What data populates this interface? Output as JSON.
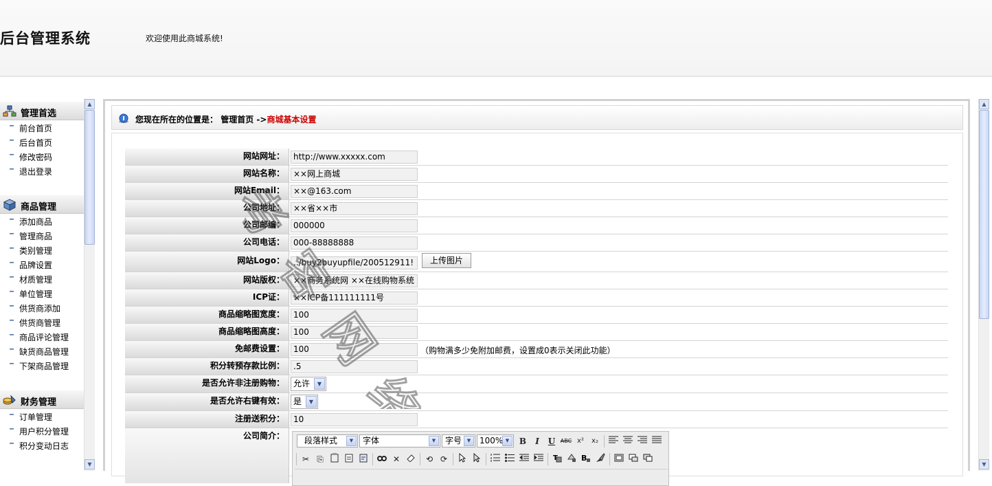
{
  "header": {
    "system_title": "后台管理系统",
    "welcome": "欢迎使用此商城系统!"
  },
  "sidebar": {
    "groups": [
      {
        "title": "管理首选",
        "icon": "sitemap-icon",
        "items": [
          "前台首页",
          "后台首页",
          "修改密码",
          "退出登录"
        ]
      },
      {
        "title": "商品管理",
        "icon": "box-icon",
        "items": [
          "添加商品",
          "管理商品",
          "类别管理",
          "品牌设置",
          "材质管理",
          "单位管理",
          "供货商添加",
          "供货商管理",
          "商品评论管理",
          "缺货商品管理",
          "下架商品管理"
        ]
      },
      {
        "title": "财务管理",
        "icon": "coins-icon",
        "items": [
          "订单管理",
          "用户积分管理",
          "积分变动日志"
        ]
      }
    ]
  },
  "breadcrumb": {
    "prefix": "您现在所在的位置是：",
    "home": "管理首页",
    "arrow": "->",
    "current": "商城基本设置"
  },
  "form": {
    "rows": [
      {
        "label": "网站网址：",
        "value": "http://www.xxxxx.com"
      },
      {
        "label": "网站名称：",
        "value": "××网上商城"
      },
      {
        "label": "网站Email：",
        "value": "××@163.com"
      },
      {
        "label": "公司地址：",
        "value": "××省××市"
      },
      {
        "label": "公司邮编：",
        "value": "000000"
      },
      {
        "label": "公司电话：",
        "value": "000-88888888"
      },
      {
        "label": "网站Logo：",
        "value": "../buy2buyupfile/200512911!",
        "button": "上传图片"
      },
      {
        "label": "网站版权：",
        "value": "××商务系统网 ××在线购物系统"
      },
      {
        "label": "ICP证：",
        "value": "××ICP备111111111号"
      },
      {
        "label": "商品缩略图宽度：",
        "value": "100"
      },
      {
        "label": "商品缩略图高度：",
        "value": "100"
      },
      {
        "label": "免邮费设置：",
        "value": "100",
        "hint": "（购物满多少免附加邮费，设置成0表示关闭此功能）"
      },
      {
        "label": "积分转预存款比例：",
        "value": ".5"
      },
      {
        "label": "是否允许非注册购物：",
        "select": "允许"
      },
      {
        "label": "是否允许右键有效：",
        "select": "是"
      },
      {
        "label": "注册送积分：",
        "value": "10"
      }
    ],
    "intro_label": "公司简介："
  },
  "editor": {
    "paragraph_select": "段落样式",
    "font_select": "字体",
    "size_select": "字号",
    "zoom_select": "100%",
    "buttons_row1": [
      "B",
      "I",
      "U",
      "ABC",
      "x²",
      "x₂"
    ],
    "buttons_row2": [
      "✂",
      "⎘",
      "📋",
      "⟲",
      "⟳"
    ]
  },
  "watermark": "考 客 网 络",
  "colors": {
    "breadcrumb_current": "#cc0000",
    "panel_border": "#d2d2d2",
    "scroll_thumb": "#c9d7f5"
  }
}
